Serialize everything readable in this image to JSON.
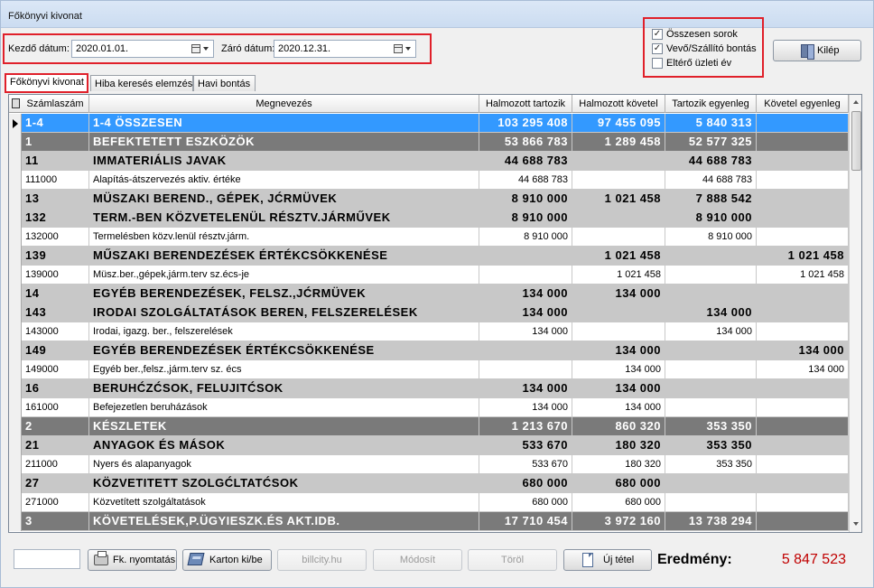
{
  "window": {
    "title": "Főkönyvi kivonat"
  },
  "dates": {
    "start_label": "Kezdő dátum:",
    "start_value": "2020.01.01.",
    "end_label": "Záró dátum:",
    "end_value": "2020.12.31."
  },
  "options": [
    {
      "label": "Összesen sorok",
      "checked": true
    },
    {
      "label": "Vevő/Szállító bontás",
      "checked": true
    },
    {
      "label": "Eltérő üzleti év",
      "checked": false
    }
  ],
  "exit_button": "Kilép",
  "tabs": [
    {
      "label": "Főkönyvi kivonat",
      "active": true
    },
    {
      "label": "Hiba keresés elemzés",
      "active": false
    },
    {
      "label": "Havi bontás",
      "active": false
    }
  ],
  "columns": [
    "Számlaszám",
    "Megnevezés",
    "Halmozott tartozik",
    "Halmozott követel",
    "Tartozik egyenleg",
    "Követel egyenleg"
  ],
  "rows": [
    {
      "style": "sel",
      "account": "1-4",
      "name": "1-4 ÖSSZESEN",
      "debit": "103 295 408",
      "credit": "97 455 095",
      "debit_bal": "5 840 313",
      "credit_bal": ""
    },
    {
      "style": "lvl1dark",
      "account": "1",
      "name": "BEFEKTETETT ESZKÖZÖK",
      "debit": "53 866 783",
      "credit": "1 289 458",
      "debit_bal": "52 577 325",
      "credit_bal": ""
    },
    {
      "style": "lvl2",
      "account": "11",
      "name": "IMMATERIÁLIS JAVAK",
      "debit": "44 688 783",
      "credit": "",
      "debit_bal": "44 688 783",
      "credit_bal": ""
    },
    {
      "style": "lvl1",
      "account": "111000",
      "name": "Alapítás-átszervezés aktiv. értéke",
      "debit": "44 688 783",
      "credit": "",
      "debit_bal": "44 688 783",
      "credit_bal": ""
    },
    {
      "style": "lvl2",
      "account": "13",
      "name": "MÜSZAKI BEREND., GÉPEK, JĆRMÜVEK",
      "debit": "8 910 000",
      "credit": "1 021 458",
      "debit_bal": "7 888 542",
      "credit_bal": ""
    },
    {
      "style": "lvl2",
      "account": "132",
      "name": "TERM.-BEN KÖZVETELENÜL RÉSZTV.JÁRMŰVEK",
      "debit": "8 910 000",
      "credit": "",
      "debit_bal": "8 910 000",
      "credit_bal": ""
    },
    {
      "style": "lvl1",
      "account": "132000",
      "name": "Termelésben közv.lenül résztv.járm.",
      "debit": "8 910 000",
      "credit": "",
      "debit_bal": "8 910 000",
      "credit_bal": ""
    },
    {
      "style": "lvl2",
      "account": "139",
      "name": "MŰSZAKI BERENDEZÉSEK ÉRTÉKCSÖKKENÉSE",
      "debit": "",
      "credit": "1 021 458",
      "debit_bal": "",
      "credit_bal": "1 021 458"
    },
    {
      "style": "lvl1",
      "account": "139000",
      "name": "Müsz.ber.,gépek,járm.terv sz.écs-je",
      "debit": "",
      "credit": "1 021 458",
      "debit_bal": "",
      "credit_bal": "1 021 458"
    },
    {
      "style": "lvl2",
      "account": "14",
      "name": "EGYÉB BERENDEZÉSEK, FELSZ.,JĆRMÜVEK",
      "debit": "134 000",
      "credit": "134 000",
      "debit_bal": "",
      "credit_bal": ""
    },
    {
      "style": "lvl2",
      "account": "143",
      "name": "IRODAI SZOLGÁLTATÁSOK BEREN, FELSZERELÉSEK",
      "debit": "134 000",
      "credit": "",
      "debit_bal": "134 000",
      "credit_bal": ""
    },
    {
      "style": "lvl1",
      "account": "143000",
      "name": "Irodai, igazg. ber., felszerelések",
      "debit": "134 000",
      "credit": "",
      "debit_bal": "134 000",
      "credit_bal": ""
    },
    {
      "style": "lvl2",
      "account": "149",
      "name": "EGYÉB BERENDEZÉSEK ÉRTÉKCSÖKKENÉSE",
      "debit": "",
      "credit": "134 000",
      "debit_bal": "",
      "credit_bal": "134 000"
    },
    {
      "style": "lvl1",
      "account": "149000",
      "name": "Egyéb ber.,felsz.,járm.terv sz. écs",
      "debit": "",
      "credit": "134 000",
      "debit_bal": "",
      "credit_bal": "134 000"
    },
    {
      "style": "lvl2",
      "account": "16",
      "name": "BERUHĆZĆSOK, FELUJITĆSOK",
      "debit": "134 000",
      "credit": "134 000",
      "debit_bal": "",
      "credit_bal": ""
    },
    {
      "style": "lvl1",
      "account": "161000",
      "name": "Befejezetlen beruházások",
      "debit": "134 000",
      "credit": "134 000",
      "debit_bal": "",
      "credit_bal": ""
    },
    {
      "style": "lvl1dark",
      "account": "2",
      "name": "KÉSZLETEK",
      "debit": "1 213 670",
      "credit": "860 320",
      "debit_bal": "353 350",
      "credit_bal": ""
    },
    {
      "style": "lvl2",
      "account": "21",
      "name": "ANYAGOK ÉS MÁSOK",
      "debit": "533 670",
      "credit": "180 320",
      "debit_bal": "353 350",
      "credit_bal": ""
    },
    {
      "style": "lvl1",
      "account": "211000",
      "name": "Nyers és alapanyagok",
      "debit": "533 670",
      "credit": "180 320",
      "debit_bal": "353 350",
      "credit_bal": ""
    },
    {
      "style": "lvl2",
      "account": "27",
      "name": "KÖZVETITETT SZOLGĆLTATĆSOK",
      "debit": "680 000",
      "credit": "680 000",
      "debit_bal": "",
      "credit_bal": ""
    },
    {
      "style": "lvl1",
      "account": "271000",
      "name": "Közvetített szolgáltatások",
      "debit": "680 000",
      "credit": "680 000",
      "debit_bal": "",
      "credit_bal": ""
    },
    {
      "style": "lvl1dark",
      "account": "3",
      "name": "KÖVETELÉSEK,P.ÜGYIESZK.ÉS AKT.IDB.",
      "debit": "17 710 454",
      "credit": "3 972 160",
      "debit_bal": "13 738 294",
      "credit_bal": ""
    }
  ],
  "bottom": {
    "print_button": "Fk. nyomtatás",
    "card_button": "Karton ki/be",
    "billcity_button": "billcity.hu",
    "modify_button": "Módosít",
    "delete_button": "Töröl",
    "new_button": "Új tétel",
    "result_label": "Eredmény:",
    "result_value": "5 847 523"
  },
  "colors": {
    "highlight": "#e0202a",
    "selection": "#3399ff",
    "result": "#c00000"
  }
}
